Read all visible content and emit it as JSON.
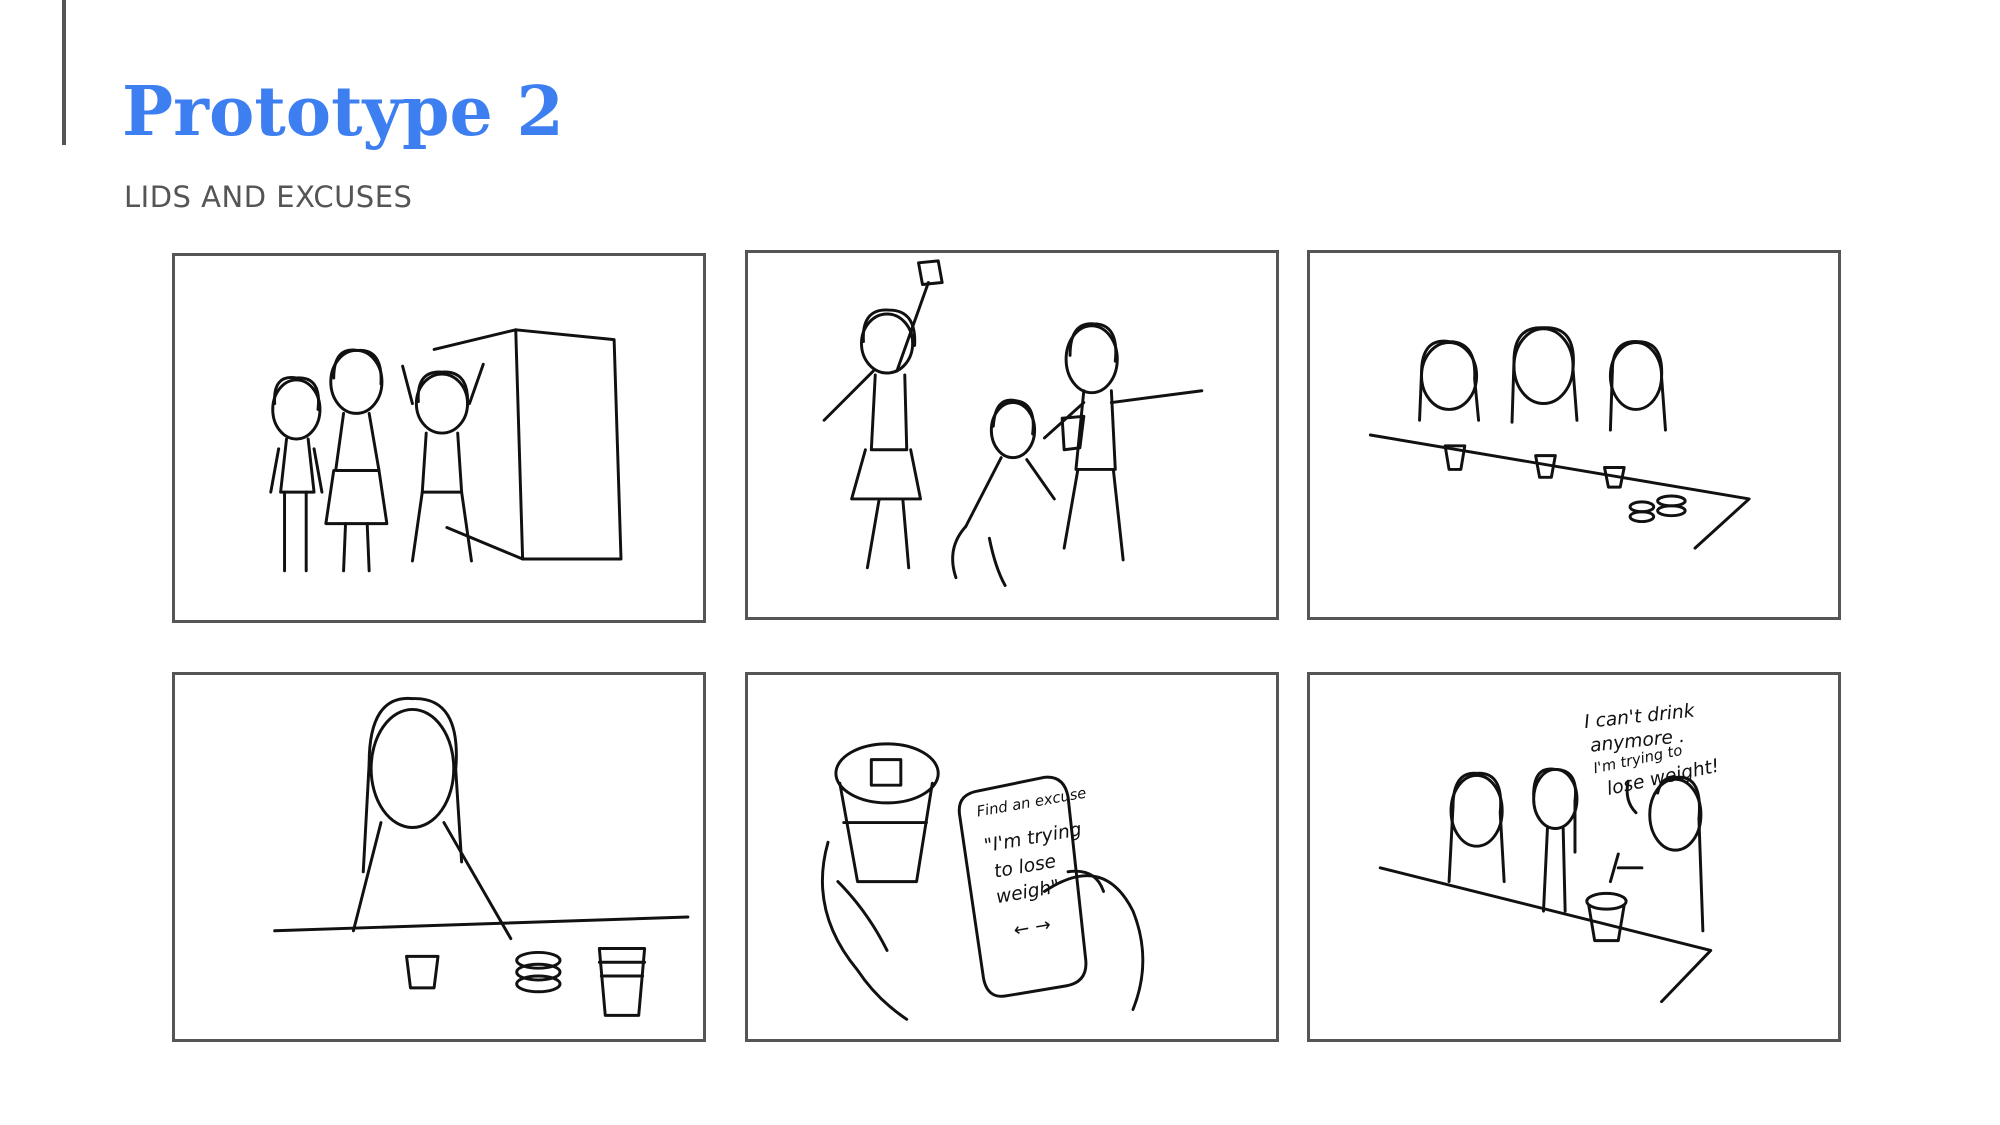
{
  "slide": {
    "title": "Prototype 2",
    "subtitle": "LIDS AND EXCUSES",
    "title_color": "#3d7ff0"
  },
  "panels": {
    "panel5": {
      "app_header": "Find an excuse",
      "app_line1": "\"I'm trying",
      "app_line2": "to lose",
      "app_line3": "weigh\"",
      "nav": "← →"
    },
    "panel6": {
      "speech_line1": "I can't drink",
      "speech_line2": "anymore .",
      "speech_line3": "I'm trying to",
      "speech_line4": "lose weight!"
    }
  }
}
